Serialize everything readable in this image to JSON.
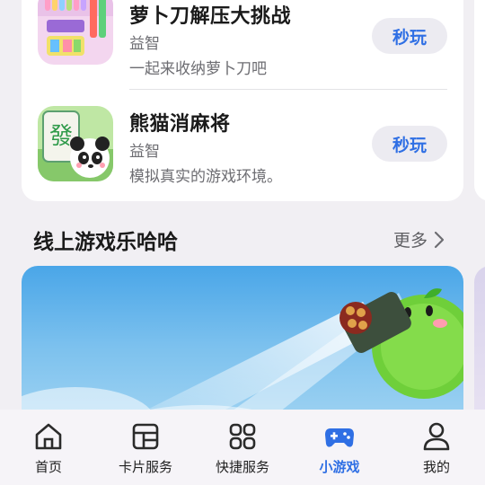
{
  "games": [
    {
      "title": "萝卜刀解压大挑战",
      "developer": "益智",
      "description": "一起来收纳萝卜刀吧",
      "play_label": "秒玩",
      "icon": "radish-knife-icon"
    },
    {
      "title": "熊猫消麻将",
      "developer": "益智",
      "description": "模拟真实的游戏环境。",
      "play_label": "秒玩",
      "icon": "panda-mahjong-icon"
    }
  ],
  "section": {
    "title": "线上游戏乐哈哈",
    "more_label": "更多"
  },
  "tabs": [
    {
      "label": "首页",
      "icon": "home-icon"
    },
    {
      "label": "卡片服务",
      "icon": "cards-icon"
    },
    {
      "label": "快捷服务",
      "icon": "grid-icon"
    },
    {
      "label": "小游戏",
      "icon": "gamepad-icon",
      "active": true
    },
    {
      "label": "我的",
      "icon": "person-icon"
    }
  ],
  "colors": {
    "accent": "#2f6fe4",
    "background": "#f1eff3"
  }
}
